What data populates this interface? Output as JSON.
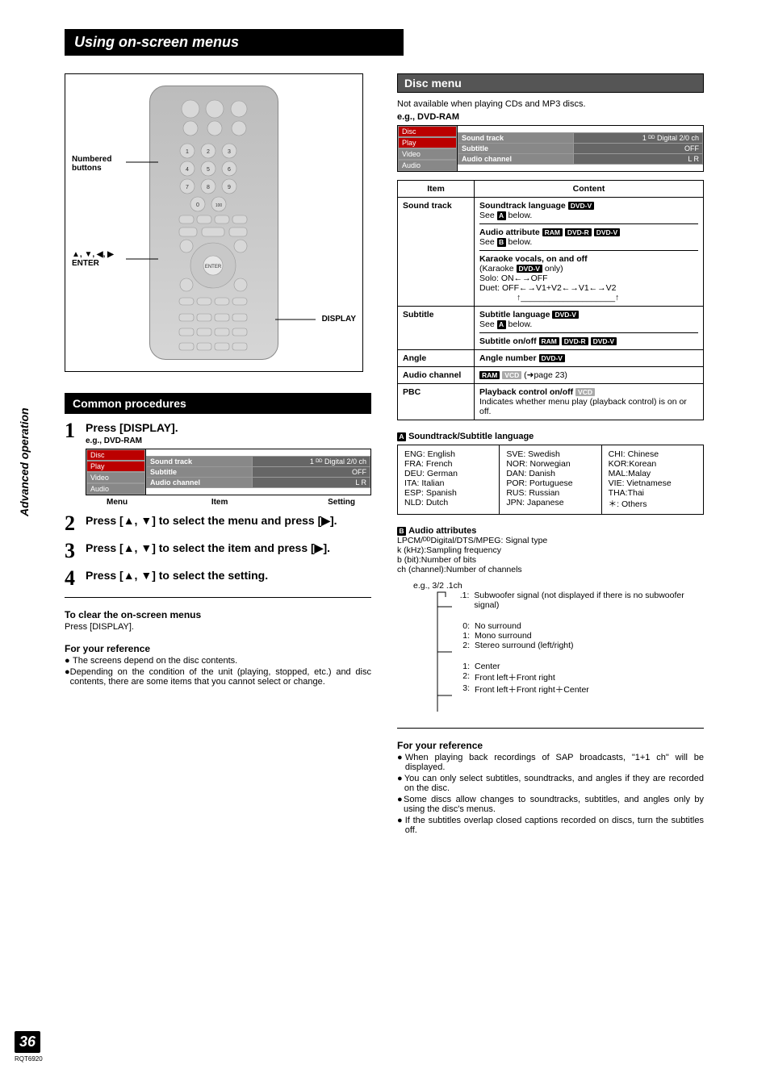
{
  "pageTitle": "Using on-screen menus",
  "sideLabel": "Advanced operation",
  "pageNumber": "36",
  "pageRef": "RQT6920",
  "remote": {
    "calloutNumbered": "Numbered\nbuttons",
    "calloutArrows": "▲, ▼, ◀, ▶\nENTER",
    "calloutDisplay": "DISPLAY"
  },
  "common": {
    "heading": "Common procedures",
    "step1": {
      "n": "1",
      "text": "Press [DISPLAY].",
      "sub": "e.g., DVD-RAM"
    },
    "step2": {
      "n": "2",
      "text": "Press [▲, ▼] to select the menu and press [▶]."
    },
    "step3": {
      "n": "3",
      "text": "Press [▲, ▼] to select the item and press [▶]."
    },
    "step4": {
      "n": "4",
      "text": "Press [▲, ▼] to select the setting."
    },
    "menuLabels": {
      "menu": "Menu",
      "item": "Item",
      "setting": "Setting"
    },
    "osd": {
      "tabs": [
        "Disc",
        "Play",
        "Video",
        "Audio"
      ],
      "rows": [
        {
          "label": "Sound track",
          "val": "1   ᴰᴰ Digital  2/0 ch"
        },
        {
          "label": "Subtitle",
          "val": "OFF"
        },
        {
          "label": "Audio channel",
          "val": "L R"
        }
      ]
    },
    "clearHeading": "To clear the on-screen menus",
    "clearBody": "Press [DISPLAY].",
    "refHeading": "For your reference",
    "ref1": "The screens depend on the disc contents.",
    "ref2": "Depending on the condition of the unit (playing, stopped, etc.) and disc contents, there are some items that you cannot select or change."
  },
  "disc": {
    "heading": "Disc menu",
    "note1": "Not available when playing CDs and MP3 discs.",
    "note2": "e.g., DVD-RAM",
    "tableHead": {
      "item": "Item",
      "content": "Content"
    },
    "rows": {
      "soundtrack": {
        "item": "Sound track",
        "c1a": "Soundtrack language",
        "c1b": "See",
        "c1c": "below.",
        "c2a": "Audio attribute",
        "c2b": "See",
        "c2c": "below.",
        "c3a": "Karaoke vocals, on and off",
        "c3b": "(Karaoke",
        "c3c": "only)",
        "c3d": "Solo: ON←→OFF",
        "c3e": "Duet: OFF←→V1+V2←→V1←→V2"
      },
      "subtitle": {
        "item": "Subtitle",
        "c1a": "Subtitle language",
        "c1b": "See",
        "c1c": "below.",
        "c2a": "Subtitle on/off"
      },
      "angle": {
        "item": "Angle",
        "c1": "Angle number"
      },
      "audioch": {
        "item": "Audio channel",
        "c1": "(➜page 23)"
      },
      "pbc": {
        "item": "PBC",
        "c1a": "Playback control on/off",
        "c1b": "Indicates whether menu play (playback control) is on or off."
      }
    },
    "aHeading": "Soundtrack/Subtitle language",
    "langs": {
      "col1": [
        "ENG: English",
        "FRA: French",
        "DEU: German",
        "ITA:   Italian",
        "ESP: Spanish",
        "NLD: Dutch"
      ],
      "col2": [
        "SVE: Swedish",
        "NOR: Norwegian",
        "DAN: Danish",
        "POR: Portuguese",
        "RUS: Russian",
        "JPN: Japanese"
      ],
      "col3": [
        "CHI: Chinese",
        "KOR:Korean",
        "MAL:Malay",
        "VIE: Vietnamese",
        "THA:Thai",
        "＊:   Others"
      ]
    },
    "bHeading": "Audio attributes",
    "attr1": "LPCM/ᴰᴰDigital/DTS/MPEG: Signal type",
    "attr2": "k (kHz):Sampling frequency",
    "attr3": "b (bit):Number of bits",
    "attr4": "ch (channel):Number of channels",
    "egLabel": "e.g., 3/2 .1ch",
    "eg": {
      "g1": [
        {
          "n": ".1:",
          "t": "Subwoofer signal (not displayed if there is no subwoofer signal)"
        }
      ],
      "g2": [
        {
          "n": "0:",
          "t": "No surround"
        },
        {
          "n": "1:",
          "t": "Mono surround"
        },
        {
          "n": "2:",
          "t": "Stereo surround (left/right)"
        }
      ],
      "g3": [
        {
          "n": "1:",
          "t": "Center"
        },
        {
          "n": "2:",
          "t": "Front left＋Front right"
        },
        {
          "n": "3:",
          "t": "Front left＋Front right＋Center"
        }
      ]
    },
    "refHeading": "For your reference",
    "ref1": "When playing back recordings of SAP broadcasts, \"1+1 ch\" will be displayed.",
    "ref2": "You can only select subtitles, soundtracks, and angles if they are recorded on the disc.",
    "ref3": "Some discs allow changes to soundtracks, subtitles, and angles only by using the disc's menus.",
    "ref4": "If the subtitles overlap closed captions recorded on discs, turn the subtitles off."
  }
}
